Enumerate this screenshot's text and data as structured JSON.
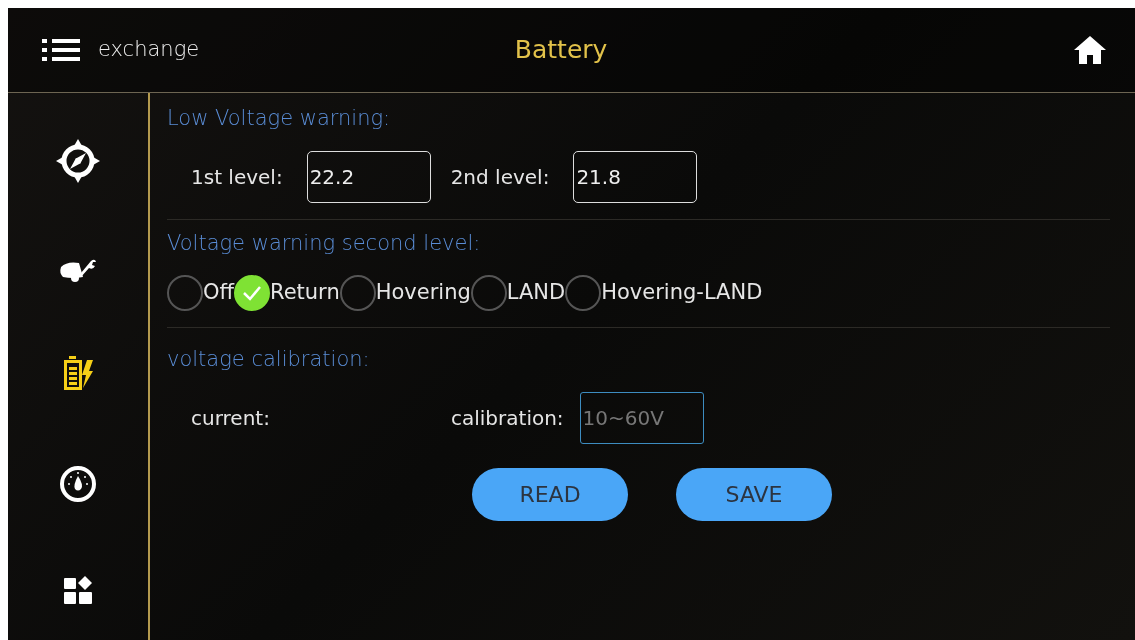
{
  "header": {
    "menu_label": "exchange",
    "title": "Battery"
  },
  "sidebar": {
    "items": [
      {
        "kind": "compass",
        "selected": false
      },
      {
        "kind": "tools",
        "selected": false
      },
      {
        "kind": "battery",
        "selected": true
      },
      {
        "kind": "gauge",
        "selected": false
      },
      {
        "kind": "apps",
        "selected": false
      }
    ]
  },
  "low_voltage": {
    "title": "Low Voltage warning:",
    "fields": [
      {
        "label": "1st level:",
        "value": "22.2"
      },
      {
        "label": "2nd level:",
        "value": "21.8"
      }
    ]
  },
  "second_level": {
    "title": "Voltage warning second level:",
    "options": [
      {
        "label": "Off",
        "selected": false
      },
      {
        "label": "Return",
        "selected": true
      },
      {
        "label": "Hovering",
        "selected": false
      },
      {
        "label": "LAND",
        "selected": false
      },
      {
        "label": "Hovering-LAND",
        "selected": false
      }
    ]
  },
  "calibration": {
    "title": "voltage calibration:",
    "current_label": "current:",
    "calibration_label": "calibration:",
    "placeholder": "10~60V"
  },
  "buttons": [
    "READ",
    "SAVE"
  ]
}
